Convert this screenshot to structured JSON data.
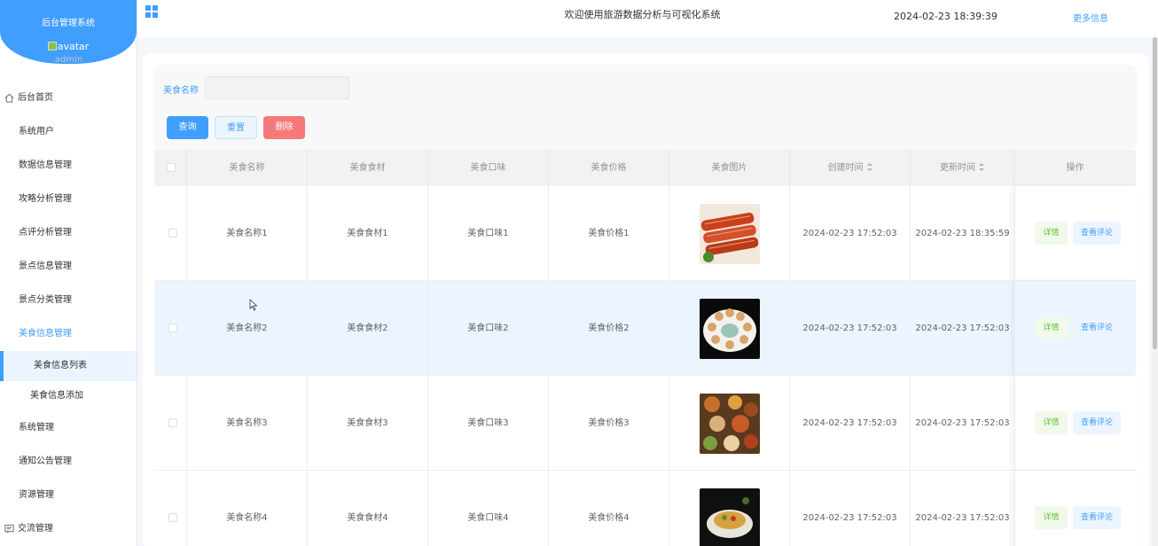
{
  "brand": {
    "system_name": "后台管理系统",
    "avatar_alt": "avatar",
    "username": "admin"
  },
  "menu": [
    {
      "label": "后台首页",
      "icon": "home-icon"
    },
    {
      "label": "系统用户"
    },
    {
      "label": "数据信息管理"
    },
    {
      "label": "攻略分析管理"
    },
    {
      "label": "点评分析管理"
    },
    {
      "label": "景点信息管理"
    },
    {
      "label": "景点分类管理"
    },
    {
      "label": "美食信息管理",
      "active": true
    },
    {
      "label": "美食信息列表",
      "sub": true,
      "selected": true
    },
    {
      "label": "美食信息添加",
      "sub": true
    },
    {
      "label": "系统管理"
    },
    {
      "label": "通知公告管理"
    },
    {
      "label": "资源管理"
    },
    {
      "label": "交流管理",
      "icon": "chat-icon"
    }
  ],
  "header": {
    "title": "欢迎使用旅游数据分析与可视化系统",
    "datetime": "2024-02-23 18:39:39",
    "more": "更多信息"
  },
  "search": {
    "label": "美食名称",
    "value": "",
    "query_btn": "查询",
    "reset_btn": "重置",
    "delete_btn": "删除"
  },
  "table": {
    "columns": [
      "美食名称",
      "美食食材",
      "美食口味",
      "美食价格",
      "美食图片",
      "创建时间",
      "更新时间",
      "操作"
    ],
    "rows": [
      {
        "name": "美食名称1",
        "ingredients": "美食食材1",
        "taste": "美食口味1",
        "price": "美食价格1",
        "created": "2024-02-23 17:52:03",
        "updated": "2024-02-23 18:35:59"
      },
      {
        "name": "美食名称2",
        "ingredients": "美食食材2",
        "taste": "美食口味2",
        "price": "美食价格2",
        "created": "2024-02-23 17:52:03",
        "updated": "2024-02-23 17:52:03"
      },
      {
        "name": "美食名称3",
        "ingredients": "美食食材3",
        "taste": "美食口味3",
        "price": "美食价格3",
        "created": "2024-02-23 17:52:03",
        "updated": "2024-02-23 17:52:03"
      },
      {
        "name": "美食名称4",
        "ingredients": "美食食材4",
        "taste": "美食口味4",
        "price": "美食价格4",
        "created": "2024-02-23 17:52:03",
        "updated": "2024-02-23 17:52:03"
      }
    ],
    "detail_btn": "详情",
    "comment_btn": "查看评论"
  },
  "colors": {
    "primary": "#409eff",
    "danger": "#f56c6c",
    "success": "#67c23a"
  }
}
